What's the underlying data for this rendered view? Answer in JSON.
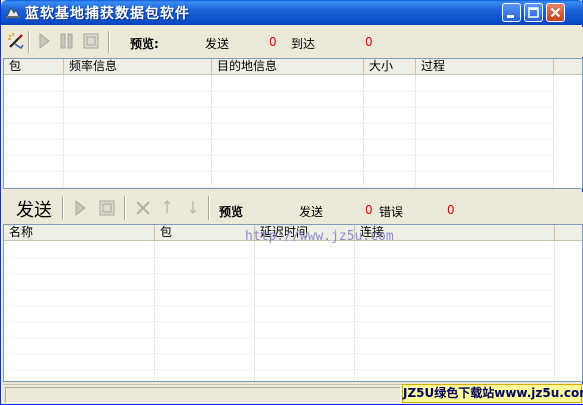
{
  "window": {
    "title": "蓝软基地捕获数据包软件"
  },
  "top_toolbar": {
    "preview_label": "预览:",
    "sent_label": "发送",
    "sent_value": "0",
    "arrived_label": "到达",
    "arrived_value": "0"
  },
  "capture_list": {
    "columns": [
      "包",
      "频率信息",
      "目的地信息",
      "大小",
      "过程"
    ]
  },
  "send_toolbar": {
    "send_label": "发送",
    "preview_label": "预览",
    "sent_label": "发送",
    "sent_value": "0",
    "error_label": "错误",
    "error_value": "0"
  },
  "send_list": {
    "columns": [
      "名称",
      "包",
      "延迟时间",
      "连接"
    ],
    "watermark": "http://www.jz5u.com"
  },
  "status": {
    "logo_text": "JZ5U绿色下载站www.jz5u.com"
  }
}
